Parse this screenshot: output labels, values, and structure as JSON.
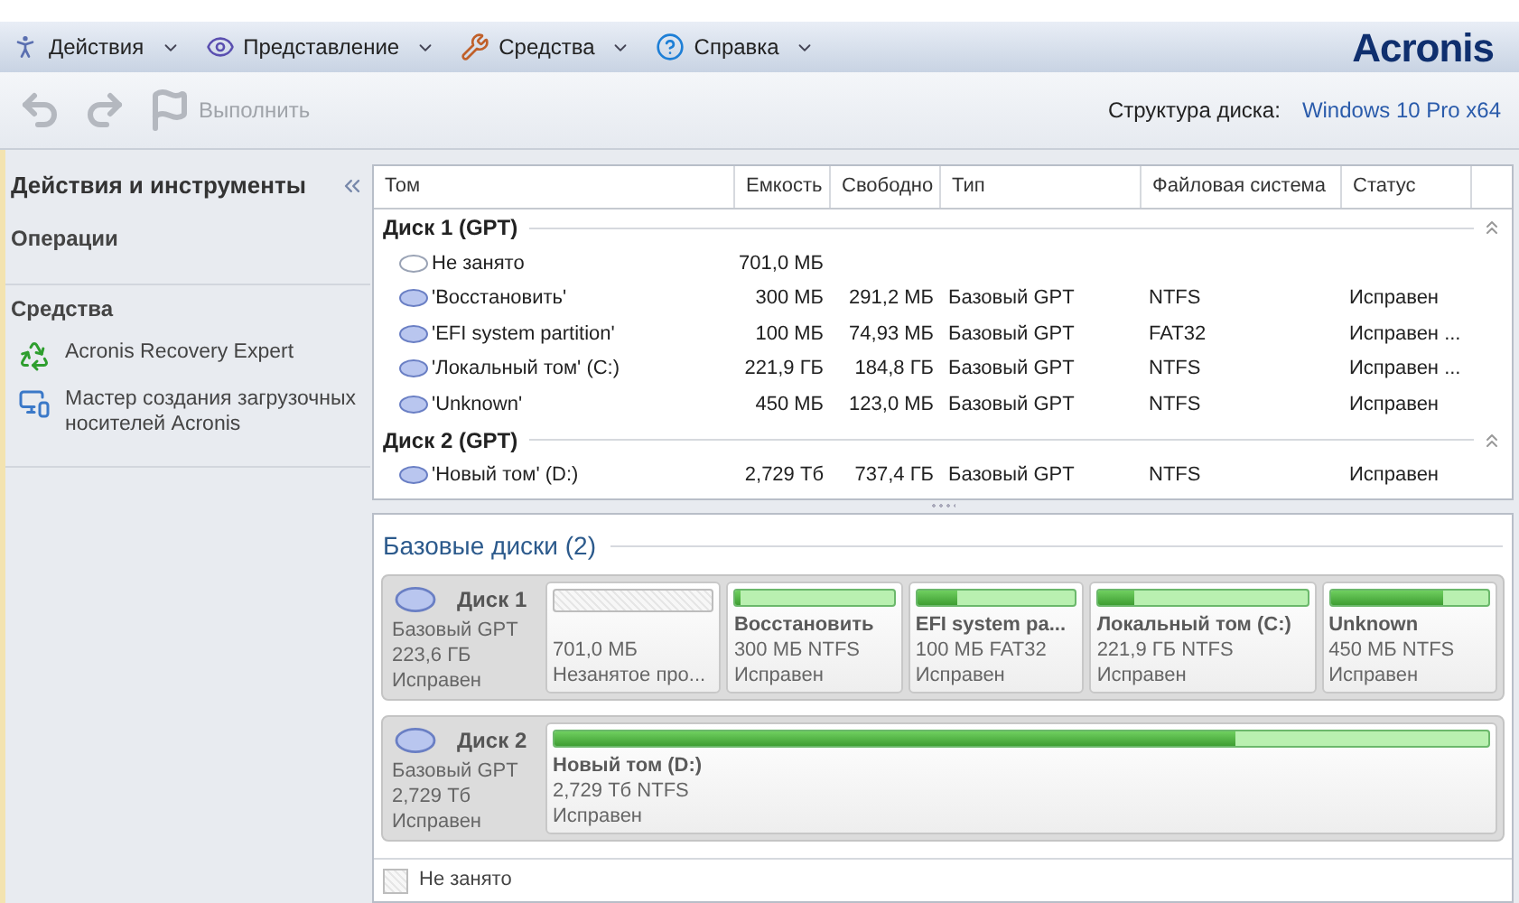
{
  "menu": [
    {
      "label": "Действия"
    },
    {
      "label": "Представление"
    },
    {
      "label": "Средства"
    },
    {
      "label": "Справка"
    }
  ],
  "brand": "Acronis",
  "toolbar": {
    "buttons": [
      {
        "kind": "undo",
        "disabled": true
      },
      {
        "kind": "redo",
        "disabled": true
      },
      {
        "kind": "run",
        "label": "Выполнить",
        "disabled": true
      }
    ],
    "layout_label": "Структура диска:",
    "layout_value": "Windows 10 Pro x64"
  },
  "sidebar": {
    "title": "Действия и инструменты",
    "sections": [
      {
        "title": "Операции"
      },
      {
        "title": "Средства",
        "items": [
          {
            "label": "Acronis Recovery Expert"
          },
          {
            "label": "Мастер создания загрузочных носителей Acronis"
          }
        ]
      }
    ]
  },
  "table": {
    "columns": [
      "Том",
      "Емкость",
      "Свободно",
      "Тип",
      "Файловая система",
      "Статус"
    ],
    "groups": [
      {
        "title": "Диск 1 (GPT)",
        "expanded": true,
        "rows": [
          {
            "kind": "unallocated",
            "cells": [
              "Не занято",
              "701,0 МБ",
              "",
              "",
              "",
              ""
            ]
          },
          {
            "kind": "partition",
            "cells": [
              "'Восстановить'",
              "300 МБ",
              "291,2 МБ",
              "Базовый GPT",
              "NTFS",
              "Исправен"
            ]
          },
          {
            "kind": "partition",
            "cells": [
              "'EFI system partition'",
              "100 МБ",
              "74,93 МБ",
              "Базовый GPT",
              "FAT32",
              "Исправен ..."
            ]
          },
          {
            "kind": "partition",
            "cells": [
              "'Локальный том' (C:)",
              "221,9 ГБ",
              "184,8 ГБ",
              "Базовый GPT",
              "NTFS",
              "Исправен ..."
            ]
          },
          {
            "kind": "partition",
            "cells": [
              "'Unknown'",
              "450 МБ",
              "123,0 МБ",
              "Базовый GPT",
              "NTFS",
              "Исправен"
            ]
          }
        ]
      },
      {
        "title": "Диск 2 (GPT)",
        "expanded": true,
        "rows": [
          {
            "kind": "partition",
            "cells": [
              "'Новый том' (D:)",
              "2,729 Тб",
              "737,4 ГБ",
              "Базовый GPT",
              "NTFS",
              "Исправен"
            ]
          }
        ]
      }
    ]
  },
  "basic_disks": {
    "title": "Базовые диски (2)",
    "disks": [
      {
        "name": "Диск 1",
        "type": "Базовый GPT",
        "size": "223,6 ГБ",
        "status": "Исправен",
        "partitions": [
          {
            "kind": "unallocated",
            "size": "701,0 МБ",
            "status": "Незанятое про..."
          },
          {
            "kind": "partition",
            "name": "Восстановить",
            "size": "300 МБ NTFS",
            "status": "Исправен",
            "level": 0.03
          },
          {
            "kind": "partition",
            "name": "EFI system pa...",
            "size": "100 МБ FAT32",
            "status": "Исправен",
            "level": 0.25
          },
          {
            "kind": "partition",
            "name": "Локальный том (C:)",
            "size": "221,9 ГБ NTFS",
            "status": "Исправен",
            "level": 0.17
          },
          {
            "kind": "partition",
            "name": "Unknown",
            "size": "450 МБ NTFS",
            "status": "Исправен",
            "level": 0.71
          }
        ]
      },
      {
        "name": "Диск 2",
        "type": "Базовый GPT",
        "size": "2,729 Тб",
        "status": "Исправен",
        "partitions": [
          {
            "kind": "partition",
            "name": "Новый том (D:)",
            "size": "2,729 Тб NTFS",
            "status": "Исправен",
            "level": 0.73
          }
        ]
      }
    ]
  },
  "legend": [
    {
      "kind": "unallocated",
      "label": "Не занято"
    }
  ]
}
